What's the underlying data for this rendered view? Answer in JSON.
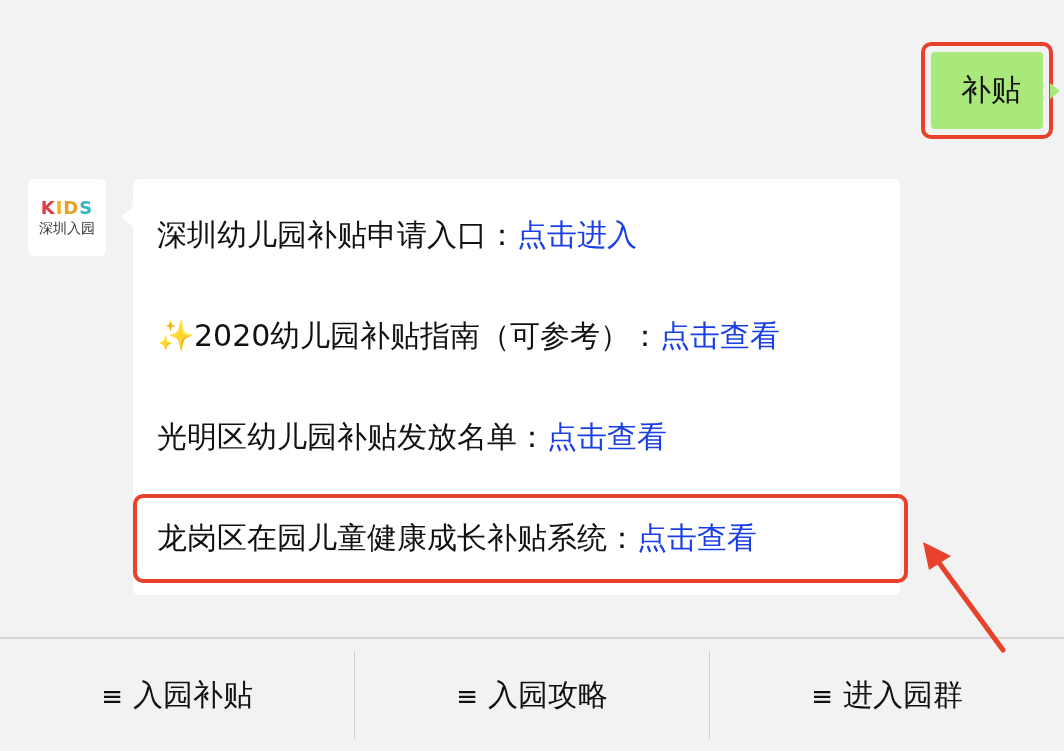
{
  "sent_message": {
    "text": "补贴",
    "highlighted": true
  },
  "received_message": {
    "avatar": {
      "brand": "KIDS",
      "name": "深圳入园"
    },
    "lines": [
      {
        "label": "深圳幼儿园补贴申请入口：",
        "link": "点击进入",
        "highlighted": false
      },
      {
        "label": "✨2020幼儿园补贴指南（可参考）：",
        "link": "点击查看",
        "highlighted": false
      },
      {
        "label": "光明区幼儿园补贴发放名单：",
        "link": "点击查看",
        "highlighted": false
      },
      {
        "label": "龙岗区在园儿童健康成长补贴系统：",
        "link": "点击查看",
        "highlighted": true
      }
    ]
  },
  "menu": [
    {
      "icon": "≡",
      "label": "入园补贴"
    },
    {
      "icon": "≡",
      "label": "入园攻略"
    },
    {
      "icon": "≡",
      "label": "进入园群"
    }
  ]
}
